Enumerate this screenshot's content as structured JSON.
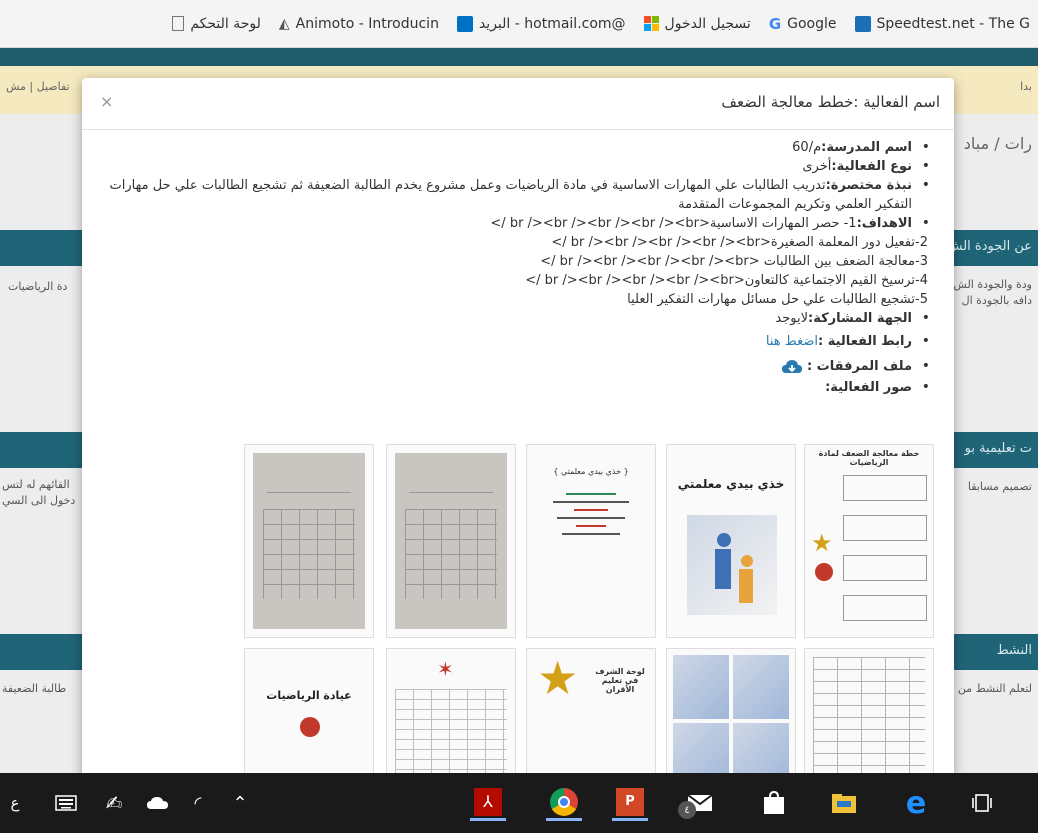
{
  "bookmarks": [
    {
      "label": "Speedtest.net - The G",
      "icon": "speedtest-icon",
      "color": "#1b6fb5"
    },
    {
      "label": "Google",
      "icon": "google-icon",
      "color": "#4285f4"
    },
    {
      "label": "تسجيل الدخول",
      "icon": "microsoft-icon",
      "color": "#f25022"
    },
    {
      "label": "البريد - hotmail.com@",
      "icon": "outlook-icon",
      "color": "#0072c6"
    },
    {
      "label": "Animoto - Introducin",
      "icon": "animoto-icon",
      "color": "#555555"
    },
    {
      "label": "لوحة التحكم",
      "icon": "page-icon",
      "color": "#777777"
    }
  ],
  "background": {
    "nav_left": "تفاصيل | مش",
    "nav_right": "بدا",
    "breadcrumb": "رات / مباد",
    "band1_label": "عن الجودة الش",
    "band1_text_right": "ودة والجودة الش",
    "band1_text_right2": "دافه بالجودة ال",
    "band1_text_left": "دة الرياضيات",
    "band2_label": "ت تعليمية بو",
    "band2_text_right": "تصميم مسابقا",
    "band2_text_left": "القائهم له لتس",
    "band2_text_left2": "دخول الى السي",
    "band3_label": "النشط",
    "band3_text_right": "لتعلم النشط من",
    "band3_text_left": "طالبة الضعيفة"
  },
  "modal": {
    "title": "اسم الفعالية :خطط معالجة الضعف",
    "close": "×",
    "school_label": "اسم المدرسة:",
    "school_value": "م/60",
    "type_label": "نوع الفعالية:",
    "type_value": "أخرى",
    "summary_label": "نبذة مختصرة:",
    "summary_value": "تدريب الطالبات علي المهارات الاساسية في مادة الرياضيات وعمل مشروع يخدم الطالبة الضعيفة ثم تشجيع الطالبات علي حل مهارات التفكير العلمي وتكريم المجموعات المتقدمة",
    "goals_label": "الاهداف:",
    "goals_first": "1- حصر المهارات الاساسية<br /><br /><br /><br /><br />",
    "goals_lines": [
      "2-تفعيل دور المعلمة الصغيرة<br /><br /><br /><br /><br />",
      "3-معالجة الضعف بين الطالبات <br /><br /><br /><br /><br />",
      "4-ترسيخ القيم الاجتماعية كالتعاون<br /><br /><br /><br /><br />",
      "5-تشجيع الطالبات علي حل مسائل مهارات التفكير العليا"
    ],
    "partner_label": "الجهة المشاركة:",
    "partner_value": "لايوجد",
    "link_label": "رابط الفعالية :",
    "link_value": "اضغط هنا",
    "attach_label": "ملف المرفقات :",
    "photos_label": "صور الفعالية:",
    "thumbs": {
      "t1_title": "خطة معالجة الضعف لمادة الرياضيات",
      "t2_title": "خذي بيدي معلمتي",
      "t3_title": "{ خذي بيدي معلمتي }",
      "t6_title": "عيادة الرياضيات",
      "t8_title": "لوحة الشرف في تعليم الأقران"
    }
  },
  "taskbar": {
    "lang_left": "ع",
    "badge": "٤",
    "accent": "#1a1a1a"
  }
}
